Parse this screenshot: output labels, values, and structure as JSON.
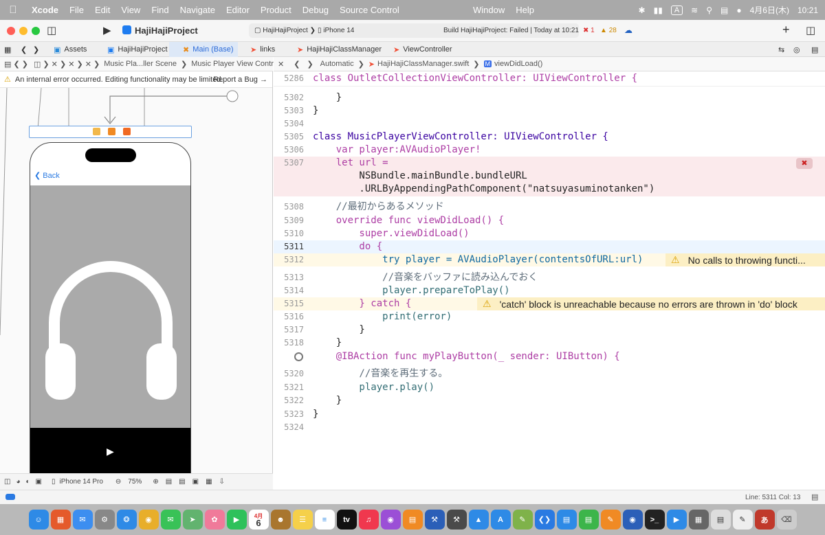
{
  "menubar": {
    "app": "Xcode",
    "items": [
      "File",
      "Edit",
      "View",
      "Find",
      "Navigate",
      "Editor",
      "Product",
      "Debug",
      "Source Control"
    ],
    "right_items": [
      "Window",
      "Help"
    ],
    "input_mode": "A",
    "date": "4月6日(木)",
    "time": "10:21"
  },
  "titlebar": {
    "project": "HajiHajiProject",
    "scheme": "HajiHajiProject",
    "device": "iPhone 14",
    "build_status": "Build HajiHajiProject: Failed | Today at 10:21",
    "errors": "1",
    "warnings": "28"
  },
  "tabs": [
    "Assets",
    "HajiHajiProject",
    "Main (Base)",
    "links",
    "HajiHajiClassManager",
    "ViewController"
  ],
  "left_jump": {
    "scene": "Music Pla...ller Scene",
    "controller": "Music Player View Controller"
  },
  "right_jump": {
    "mode": "Automatic",
    "file": "HajiHajiClassManager.swift",
    "method": "viewDidLoad()"
  },
  "warning_bar": {
    "text": "An internal error occurred. Editing functionality may be limited.",
    "action": "Report a Bug"
  },
  "storyboard": {
    "back_label": "Back"
  },
  "bottom_bar": {
    "device": "iPhone 14 Pro",
    "zoom": "75%"
  },
  "code_lines": [
    {
      "num": "5286",
      "text": "class OutletCollectionViewController: UIViewController {"
    },
    {
      "num": "5302",
      "text": "    }"
    },
    {
      "num": "5303",
      "text": "}"
    },
    {
      "num": "5304",
      "text": ""
    },
    {
      "num": "5305",
      "text": "class MusicPlayerViewController: UIViewController {"
    },
    {
      "num": "5306",
      "text": "    var player:AVAudioPlayer!"
    },
    {
      "num": "5307",
      "text": "    let url ="
    },
    {
      "num": "",
      "text": "        NSBundle.mainBundle.bundleURL"
    },
    {
      "num": "",
      "text": "        .URLByAppendingPathComponent(\"natsuyasuminotanken\")"
    },
    {
      "num": "5308",
      "text": "    //最初からあるメソッド"
    },
    {
      "num": "5309",
      "text": "    override func viewDidLoad() {"
    },
    {
      "num": "5310",
      "text": "        super.viewDidLoad()"
    },
    {
      "num": "5311",
      "text": "        do {"
    },
    {
      "num": "5312",
      "text": "            try player = AVAudioPlayer(contentsOfURL:url)"
    },
    {
      "num": "5313",
      "text": "            //音楽をバッファに読み込んでおく"
    },
    {
      "num": "5314",
      "text": "            player.prepareToPlay()"
    },
    {
      "num": "5315",
      "text": "        } catch {"
    },
    {
      "num": "5316",
      "text": "            print(error)"
    },
    {
      "num": "5317",
      "text": "        }"
    },
    {
      "num": "5318",
      "text": "    }"
    },
    {
      "num": "",
      "text": "    @IBAction func myPlayButton(_ sender: UIButton) {"
    },
    {
      "num": "5320",
      "text": "        //音楽を再生する。"
    },
    {
      "num": "5321",
      "text": "        player.play()"
    },
    {
      "num": "5322",
      "text": "    }"
    },
    {
      "num": "5323",
      "text": "}"
    },
    {
      "num": "5324",
      "text": ""
    }
  ],
  "issues": {
    "w5312": "No calls to throwing functi...",
    "w5315": "'catch' block is unreachable because no errors are thrown in 'do' block"
  },
  "status": {
    "position": "Line: 5311  Col: 13"
  },
  "dock_calendar": {
    "month": "4月",
    "day": "6"
  }
}
